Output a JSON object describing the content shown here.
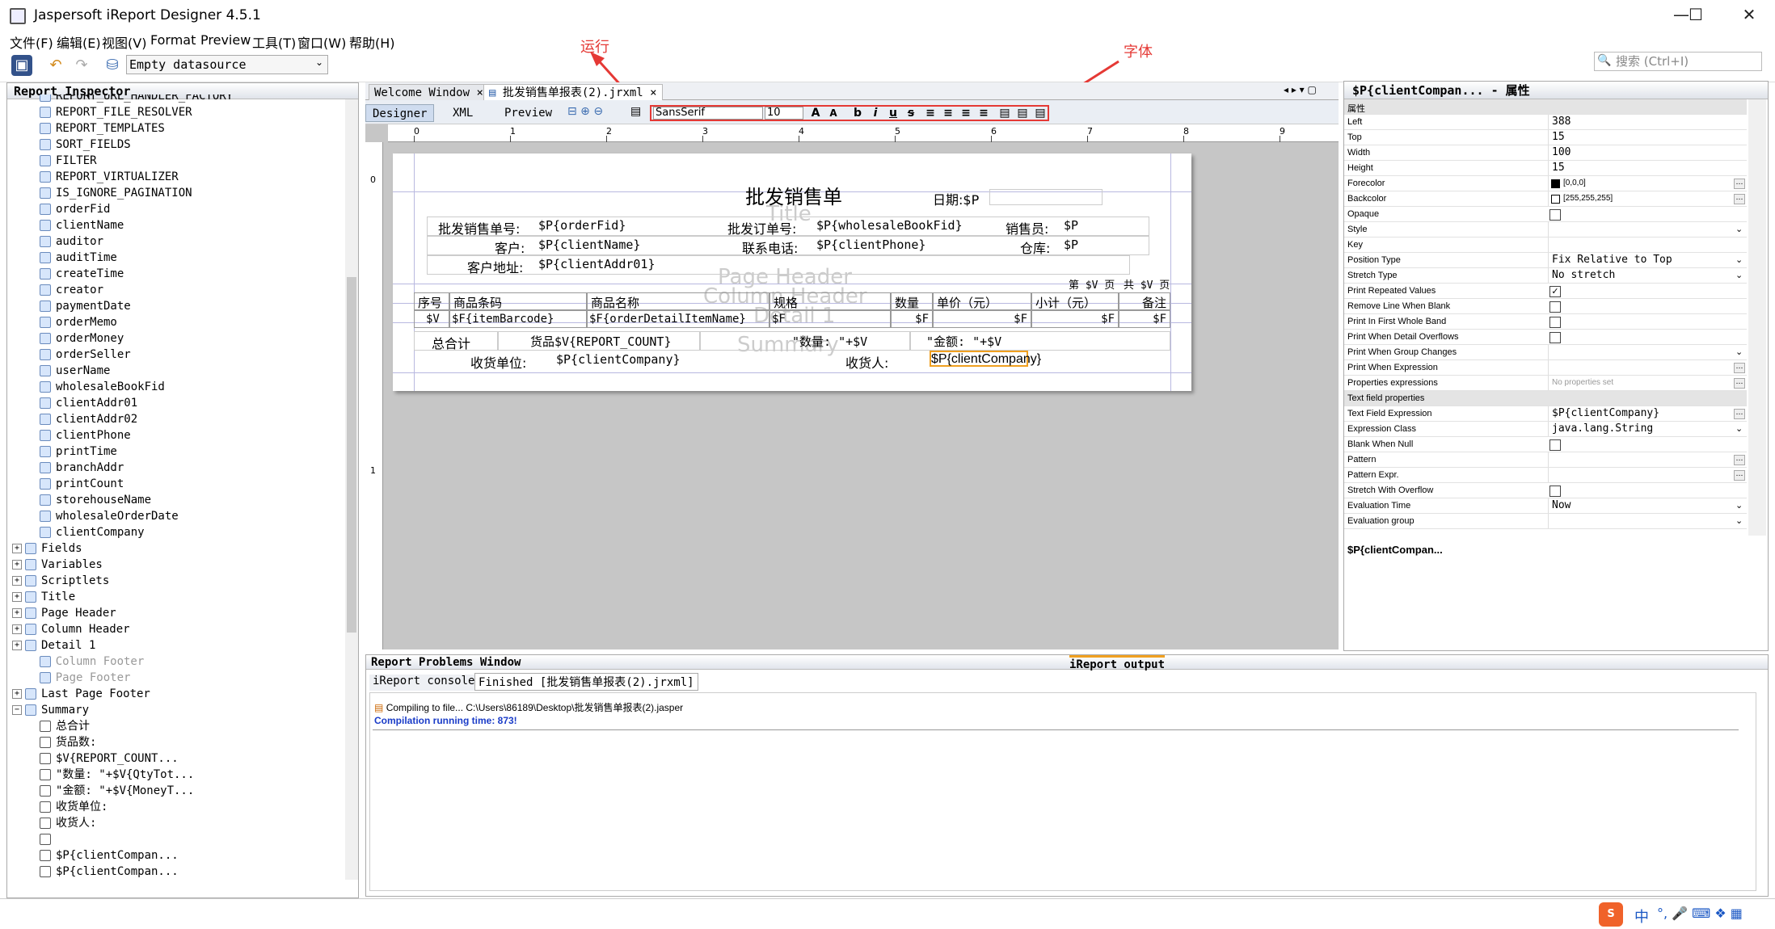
{
  "window": {
    "title": "Jaspersoft iReport Designer 4.5.1"
  },
  "menu": [
    "文件(F)",
    "编辑(E)",
    "视图(V)",
    "Format",
    "Preview",
    "工具(T)",
    "窗口(W)",
    "帮助(H)"
  ],
  "toolbar": {
    "datasource": "Empty datasource",
    "search_placeholder": "搜索 (Ctrl+I)"
  },
  "annotations": {
    "run": "运行",
    "font": "字体"
  },
  "report_inspector": {
    "title": "Report Inspector",
    "params": [
      "REPORT_URL_HANDLER_FACTORY",
      "REPORT_FILE_RESOLVER",
      "REPORT_TEMPLATES",
      "SORT_FIELDS",
      "FILTER",
      "REPORT_VIRTUALIZER",
      "IS_IGNORE_PAGINATION",
      "orderFid",
      "clientName",
      "auditor",
      "auditTime",
      "createTime",
      "creator",
      "paymentDate",
      "orderMemo",
      "orderMoney",
      "orderSeller",
      "userName",
      "wholesaleBookFid",
      "clientAddr01",
      "clientAddr02",
      "clientPhone",
      "printTime",
      "branchAddr",
      "printCount",
      "storehouseName",
      "wholesaleOrderDate",
      "clientCompany"
    ],
    "nodes": [
      "Fields",
      "Variables",
      "Scriptlets",
      "Title",
      "Page Header",
      "Column Header",
      "Detail 1",
      "Column Footer",
      "Page Footer",
      "Last Page Footer",
      "Summary"
    ],
    "summary_children": [
      "总合计",
      "货品数:",
      "$V{REPORT_COUNT...",
      "\"数量: \"+$V{QtyTot...",
      "\"金额: \"+$V{MoneyT...",
      "收货单位:",
      "收货人:",
      "",
      "$P{clientCompan...",
      "$P{clientCompan..."
    ]
  },
  "editor": {
    "tabs": [
      "Welcome Window",
      "批发销售单报表(2).jrxml"
    ],
    "views": [
      "Designer",
      "XML",
      "Preview"
    ],
    "font_name": "SansSerif",
    "font_size": "10",
    "ruler": [
      "0",
      "1",
      "2",
      "3",
      "4",
      "5",
      "6",
      "7",
      "8",
      "9"
    ]
  },
  "report": {
    "title": "批发销售单",
    "date_label": "日期:$P",
    "rows": {
      "r1": [
        "批发销售单号:",
        "$P{orderFid}",
        "批发订单号:",
        "$P{wholesaleBookFid}",
        "销售员:",
        "$P"
      ],
      "r2": [
        "客户:",
        "$P{clientName}",
        "联系电话:",
        "$P{clientPhone}",
        "仓库:",
        "$P"
      ],
      "r3": [
        "客户地址:",
        "$P{clientAddr01}"
      ]
    },
    "page_text": [
      "第 $V 页",
      "共 $V 页"
    ],
    "band_labels": [
      "Title",
      "Page Header",
      "Column Header",
      "Detail 1",
      "Summary"
    ],
    "col_headers": [
      "序号",
      "商品条码",
      "商品名称",
      "规格",
      "数量",
      "单价（元）",
      "小计（元）",
      "备注"
    ],
    "detail": [
      "$V",
      "$F{itemBarcode}",
      "$F{orderDetailItemName}",
      "$F",
      "$F",
      "$F",
      "$F",
      "$F"
    ],
    "summary": [
      "总合计",
      "货品$V{REPORT_COUNT}",
      "\"数量: \"+$V",
      "\"金额: \"+$V",
      "收货单位:",
      "$P{clientCompany}",
      "收货人:",
      "$P{clientCompany}"
    ]
  },
  "properties": {
    "title": "$P{clientCompan... - 属性",
    "section": "属性",
    "items": [
      [
        "Left",
        "388"
      ],
      [
        "Top",
        "15"
      ],
      [
        "Width",
        "100"
      ],
      [
        "Height",
        "15"
      ],
      [
        "Forecolor",
        "[0,0,0]"
      ],
      [
        "Backcolor",
        "[255,255,255]"
      ],
      [
        "Opaque",
        ""
      ],
      [
        "Style",
        ""
      ],
      [
        "Key",
        ""
      ],
      [
        "Position Type",
        "Fix Relative to Top"
      ],
      [
        "Stretch Type",
        "No stretch"
      ],
      [
        "Print Repeated Values",
        ""
      ],
      [
        "Remove Line When Blank",
        ""
      ],
      [
        "Print In First Whole Band",
        ""
      ],
      [
        "Print When Detail Overflows",
        ""
      ],
      [
        "Print When Group Changes",
        ""
      ],
      [
        "Print When Expression",
        ""
      ],
      [
        "Properties expressions",
        "No properties set"
      ]
    ],
    "section2": "Text field properties",
    "items2": [
      [
        "Text Field Expression",
        "$P{clientCompany}"
      ],
      [
        "Expression Class",
        "java.lang.String"
      ],
      [
        "Blank When Null",
        ""
      ],
      [
        "Pattern",
        ""
      ],
      [
        "Pattern Expr.",
        ""
      ],
      [
        "Stretch With Overflow",
        ""
      ],
      [
        "Evaluation Time",
        "Now"
      ],
      [
        "Evaluation group",
        ""
      ]
    ],
    "footer": "$P{clientCompan..."
  },
  "bottom": {
    "problems": "Report Problems Window",
    "output": "iReport output",
    "tabs": [
      "iReport console",
      "Finished [批发销售单报表(2).jrxml]"
    ],
    "line1": "Compiling to file... C:\\Users\\86189\\Desktop\\批发销售单报表(2).jasper",
    "line2": "Compilation running time: 873!"
  },
  "status": {
    "ime": "中"
  }
}
